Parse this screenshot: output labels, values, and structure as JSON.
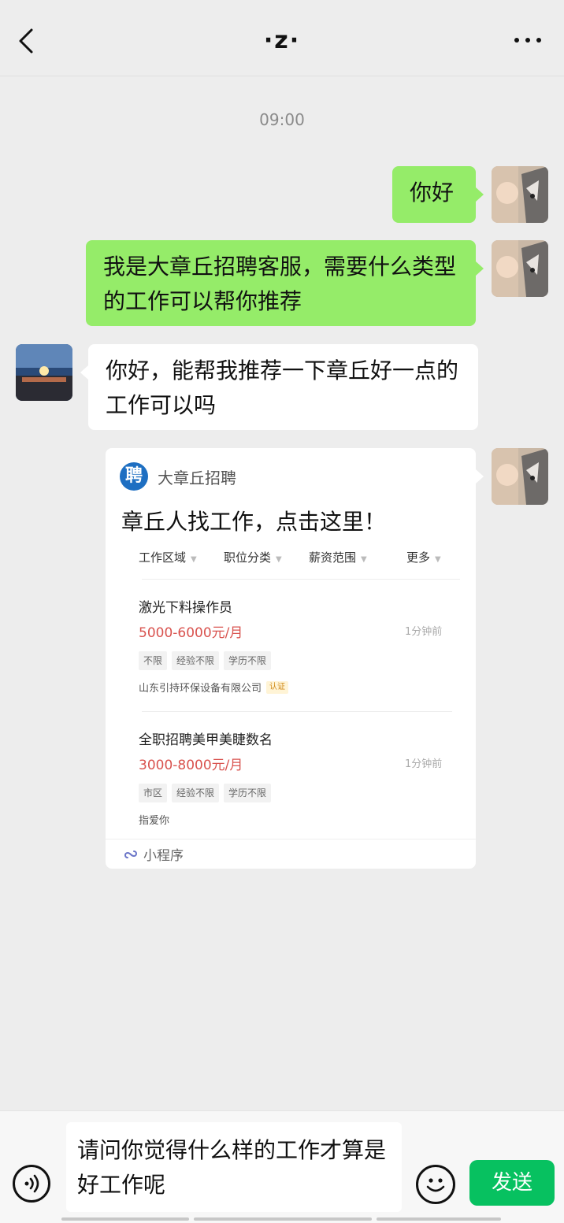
{
  "header": {
    "title": "·z·"
  },
  "chat": {
    "timestamp": "09:00",
    "messages": [
      {
        "side": "right",
        "text": "你好"
      },
      {
        "side": "right",
        "text": "我是大章丘招聘客服，需要什么类型的工作可以帮你推荐"
      },
      {
        "side": "left",
        "text": "你好，能帮我推荐一下章丘好一点的工作可以吗"
      }
    ],
    "card": {
      "logo_text": "聘",
      "brand": "大章丘招聘",
      "title": "章丘人找工作，点击这里！",
      "filters": [
        "工作区域",
        "职位分类",
        "薪资范围",
        "更多"
      ],
      "jobs": [
        {
          "title": "激光下料操作员",
          "salary": "5000-6000元/月",
          "time": "1分钟前",
          "tags": [
            "不限",
            "经验不限",
            "学历不限"
          ],
          "company": "山东引持环保设备有限公司",
          "verified": "认证"
        },
        {
          "title": "全职招聘美甲美睫数名",
          "salary": "3000-8000元/月",
          "time": "1分钟前",
          "tags": [
            "市区",
            "经验不限",
            "学历不限"
          ],
          "company": "指爱你"
        }
      ],
      "footer": "小程序"
    }
  },
  "input": {
    "text": "请问你觉得什么样的工作才算是好工作呢",
    "send_label": "发送"
  }
}
